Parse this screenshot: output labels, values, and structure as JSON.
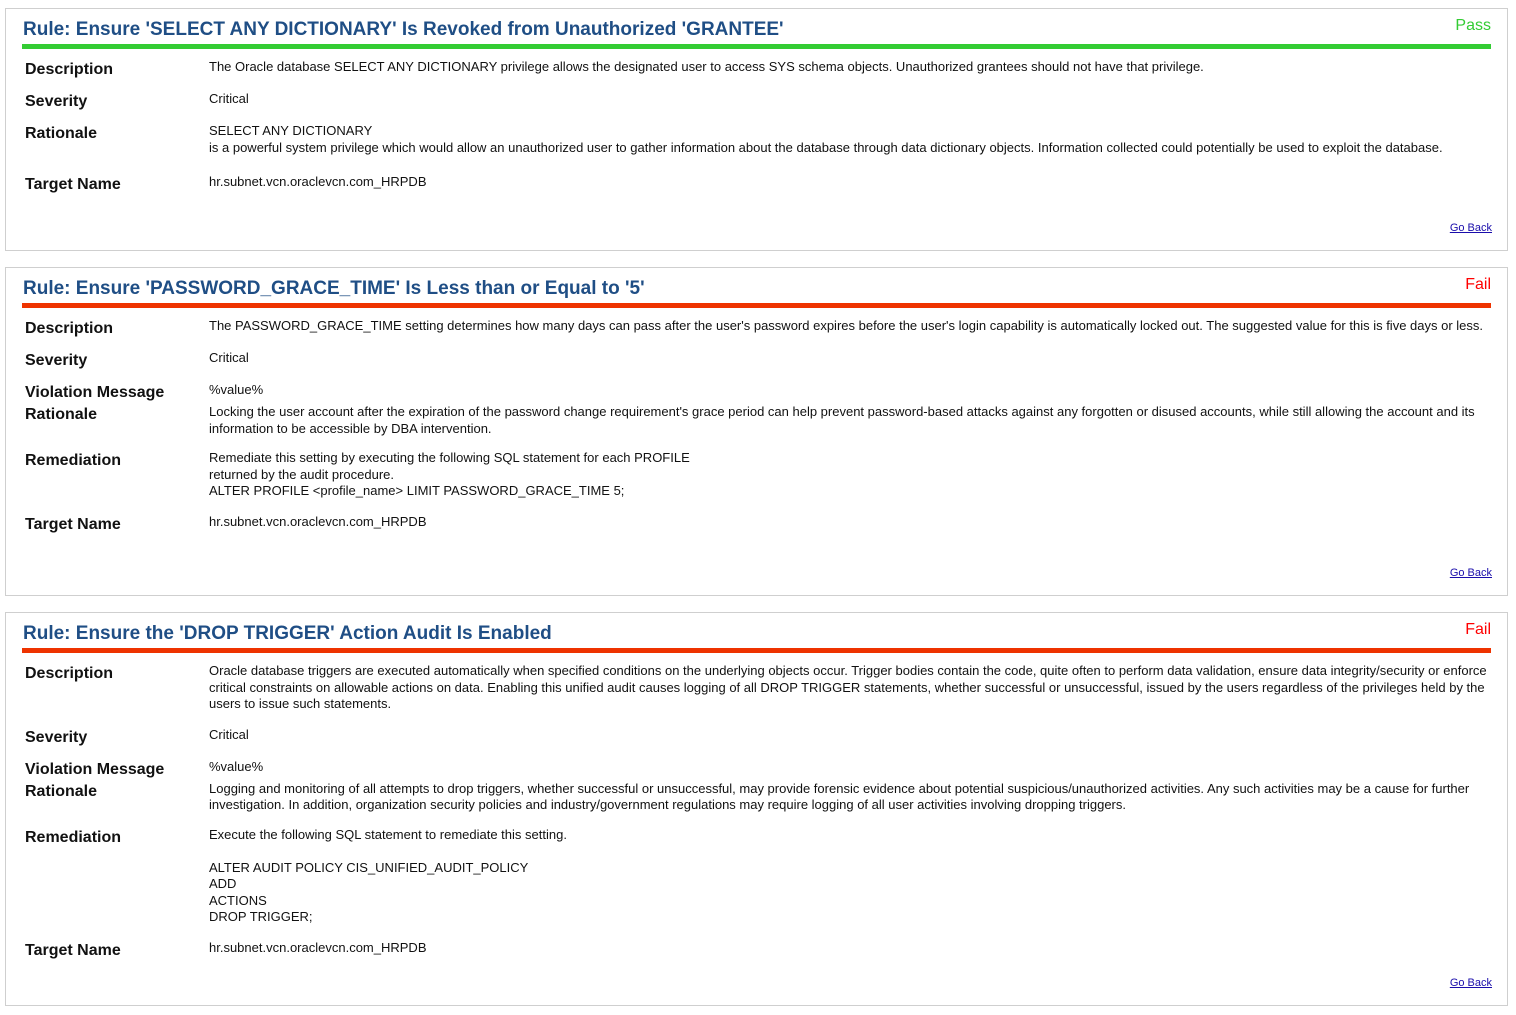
{
  "colors": {
    "title": "#1f4e85",
    "pass": "#33cc33",
    "fail": "#ee3300",
    "fail_text": "#ff0000"
  },
  "labels": {
    "description": "Description",
    "severity": "Severity",
    "rationale": "Rationale",
    "violation": "Violation Message",
    "remediation": "Remediation",
    "target": "Target Name",
    "go_back": "Go Back"
  },
  "rules": [
    {
      "title": "Rule: Ensure 'SELECT ANY DICTIONARY' Is Revoked from Unauthorized 'GRANTEE'",
      "status": "Pass",
      "description": "The Oracle database SELECT ANY DICTIONARY privilege allows the designated user to access SYS schema objects. Unauthorized grantees should not have that privilege.",
      "severity": "Critical",
      "rationale": "SELECT ANY DICTIONARY\nis a powerful system privilege which would allow an unauthorized user to gather information about the database through data dictionary objects. Information collected could potentially be used to exploit the database.",
      "target": "hr.subnet.vcn.oraclevcn.com_HRPDB"
    },
    {
      "title": "Rule: Ensure 'PASSWORD_GRACE_TIME' Is Less than or Equal to '5'",
      "status": "Fail",
      "description": "The PASSWORD_GRACE_TIME setting determines how many days can pass after the user's password expires before the user's login capability is automatically locked out. The suggested value for this is five days or less.",
      "severity": "Critical",
      "violation": "%value%",
      "rationale": "Locking the user account after the expiration of the password change requirement's grace period can help prevent password-based attacks against any forgotten or disused accounts, while still allowing the account and its information to be accessible by DBA intervention.",
      "remediation": "Remediate this setting by executing the following SQL statement for each PROFILE\nreturned by the audit procedure.\nALTER PROFILE <profile_name> LIMIT PASSWORD_GRACE_TIME 5;",
      "target": "hr.subnet.vcn.oraclevcn.com_HRPDB"
    },
    {
      "title": "Rule: Ensure the 'DROP TRIGGER' Action Audit Is Enabled",
      "status": "Fail",
      "description": "Oracle database triggers are executed automatically when specified conditions on the underlying objects occur. Trigger bodies contain the code, quite often to perform data validation, ensure data integrity/security or enforce critical constraints on allowable actions on data. Enabling this unified audit causes logging of all DROP TRIGGER statements, whether successful or unsuccessful, issued by the users regardless of the privileges held by the users to issue such statements.",
      "severity": "Critical",
      "violation": "%value%",
      "rationale": "Logging and monitoring of all attempts to drop triggers, whether successful or unsuccessful, may provide forensic evidence about potential suspicious/unauthorized activities. Any such activities may be a cause for further investigation. In addition, organization security policies and industry/government regulations may require logging of all user activities involving dropping triggers.",
      "remediation": "Execute the following SQL statement to remediate this setting.\n\nALTER AUDIT POLICY CIS_UNIFIED_AUDIT_POLICY\nADD\nACTIONS\nDROP TRIGGER;",
      "target": "hr.subnet.vcn.oraclevcn.com_HRPDB"
    }
  ]
}
